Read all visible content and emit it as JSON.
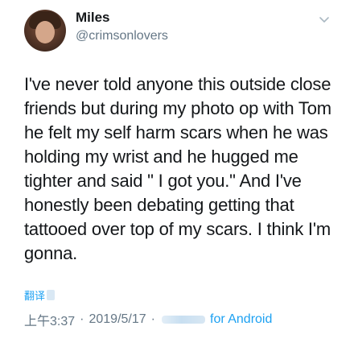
{
  "tweet": {
    "author_name": "Miles",
    "author_handle": "@crimsonlovers",
    "text": "I've never told anyone this outside close friends but during my photo op with Tom he felt my self harm scars when he was holding my wrist and he hugged me tighter and said \" I got you.\" And I've honestly been debating getting that tattooed over top of my scars. I think I'm gonna.",
    "translate_label": "翻译",
    "time": "上午3:37",
    "separator": "·",
    "date": "2019/5/17",
    "source": "for Android"
  },
  "icons": {
    "menu": "chevron-down-icon",
    "avatar": "avatar"
  },
  "colors": {
    "link": "#1da1f2",
    "secondary_text": "#657786",
    "primary_text": "#14171a"
  }
}
